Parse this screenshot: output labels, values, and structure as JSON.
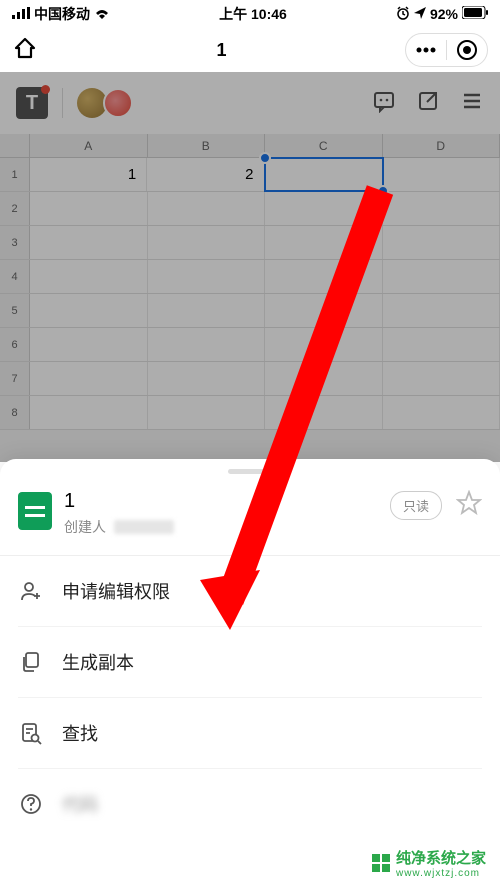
{
  "status_bar": {
    "carrier": "中国移动",
    "time": "上午 10:46",
    "battery": "92%"
  },
  "nav": {
    "title": "1"
  },
  "spreadsheet": {
    "columns": [
      "A",
      "B",
      "C",
      "D"
    ],
    "rows": [
      "1",
      "2",
      "3",
      "4",
      "5",
      "6",
      "7",
      "8"
    ],
    "cells": {
      "A1": "1",
      "B1": "2"
    },
    "selected_cell": "C1"
  },
  "sheet": {
    "doc_title": "1",
    "creator_label": "创建人",
    "readonly_label": "只读",
    "menu": [
      {
        "icon": "person-add-icon",
        "label": "申请编辑权限"
      },
      {
        "icon": "copy-icon",
        "label": "生成副本"
      },
      {
        "icon": "search-doc-icon",
        "label": "查找"
      },
      {
        "icon": "help-icon",
        "label": "代码"
      }
    ]
  },
  "watermark": {
    "text": "纯净系统之家",
    "url": "www.wjxtzj.com"
  }
}
